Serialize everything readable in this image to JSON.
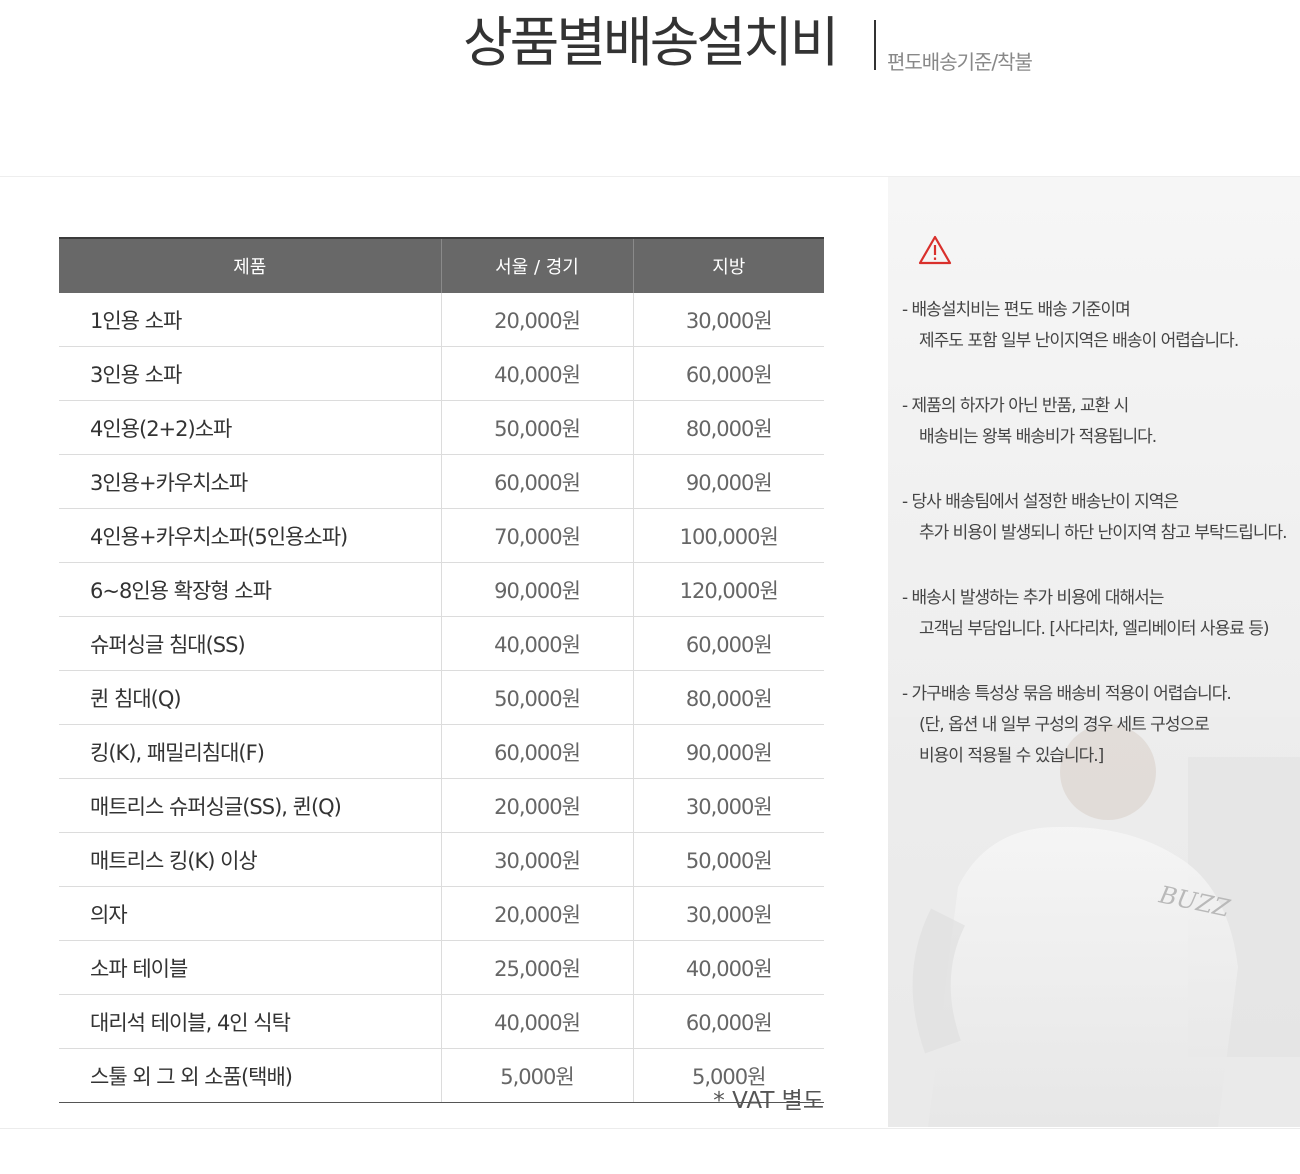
{
  "header": {
    "title": "상품별배송설치비",
    "subtitle": "편도배송기준/착불"
  },
  "table": {
    "columns": [
      "제품",
      "서울 / 경기",
      "지방"
    ],
    "rows": [
      [
        "1인용 소파",
        "20,000원",
        "30,000원"
      ],
      [
        "3인용 소파",
        "40,000원",
        "60,000원"
      ],
      [
        "4인용(2+2)소파",
        "50,000원",
        "80,000원"
      ],
      [
        "3인용+카우치소파",
        "60,000원",
        "90,000원"
      ],
      [
        "4인용+카우치소파(5인용소파)",
        "70,000원",
        "100,000원"
      ],
      [
        "6~8인용 확장형 소파",
        "90,000원",
        "120,000원"
      ],
      [
        "슈퍼싱글 침대(SS)",
        "40,000원",
        "60,000원"
      ],
      [
        "퀸 침대(Q)",
        "50,000원",
        "80,000원"
      ],
      [
        "킹(K), 패밀리침대(F)",
        "60,000원",
        "90,000원"
      ],
      [
        "매트리스 슈퍼싱글(SS), 퀸(Q)",
        "20,000원",
        "30,000원"
      ],
      [
        "매트리스 킹(K) 이상",
        "30,000원",
        "50,000원"
      ],
      [
        "의자",
        "20,000원",
        "30,000원"
      ],
      [
        "소파 테이블",
        "25,000원",
        "40,000원"
      ],
      [
        "대리석 테이블, 4인 식탁",
        "40,000원",
        "60,000원"
      ],
      [
        "스툴 외 그 외 소품(택배)",
        "5,000원",
        "5,000원"
      ]
    ],
    "vat_note": "* VAT 별도"
  },
  "notice": {
    "icon": "warning-icon",
    "accent_color": "#d9302c",
    "notes": [
      [
        "배송설치비는 편도 배송 기준이며",
        "제주도 포함 일부 난이지역은 배송이 어렵습니다."
      ],
      [
        "제품의 하자가 아닌 반품, 교환 시",
        "배송비는 왕복 배송비가 적용됩니다."
      ],
      [
        "당사 배송팀에서 설정한 배송난이 지역은",
        "추가 비용이 발생되니 하단 난이지역 참고 부탁드립니다."
      ],
      [
        "배송시 발생하는 추가 비용에 대해서는",
        "고객님 부담입니다. [사다리차, 엘리베이터 사용료 등)"
      ],
      [
        "가구배송 특성상 묶음 배송비 적용이 어렵습니다.",
        "(단, 옵션 내 일부 구성의 경우 세트 구성으로",
        "비용이 적용될 수 있습니다.]"
      ]
    ],
    "photo_text": "BUZZ"
  }
}
